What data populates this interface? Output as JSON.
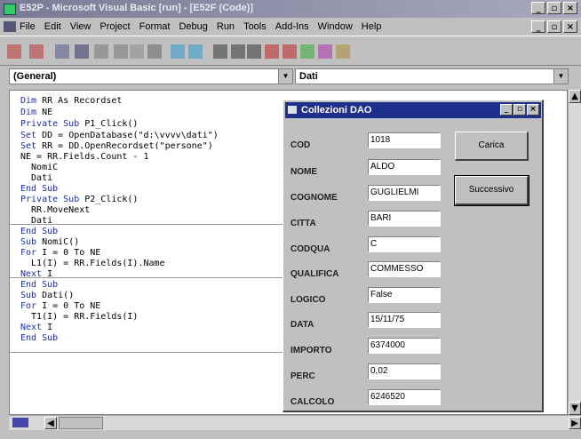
{
  "window": {
    "title": "E52P - Microsoft Visual Basic [run] - [E52F (Code)]"
  },
  "menu": [
    "File",
    "Edit",
    "View",
    "Project",
    "Format",
    "Debug",
    "Run",
    "Tools",
    "Add-Ins",
    "Window",
    "Help"
  ],
  "toolbar_icons": [
    "add-form-icon",
    "add-module-icon",
    "menu-editor-icon",
    "save-icon",
    "cut-icon",
    "copy-icon",
    "paste-icon",
    "find-icon",
    "undo-icon",
    "redo-icon",
    "start-icon",
    "pause-icon",
    "stop-icon",
    "project-explorer-icon",
    "properties-icon",
    "form-layout-icon",
    "object-browser-icon",
    "toolbox-icon"
  ],
  "object_combo": {
    "value": "(General)"
  },
  "proc_combo": {
    "value": "Dati"
  },
  "code": [
    [
      "Dim ",
      "RR As Recordset"
    ],
    [
      "Dim ",
      "NE"
    ],
    [
      "Private Sub ",
      "P1_Click()"
    ],
    [
      "Set ",
      "DD = OpenDatabase(\"d:\\vvvv\\dati\")"
    ],
    [
      "Set ",
      "RR = DD.OpenRecordset(\"persone\")"
    ],
    [
      "",
      "NE = RR.Fields.Count - 1"
    ],
    [
      "",
      "  NomiC"
    ],
    [
      "",
      "  Dati"
    ],
    [
      "End Sub",
      ""
    ],
    [
      "Private Sub ",
      "P2_Click()"
    ],
    [
      "",
      "  RR.MoveNext"
    ],
    [
      "",
      "  Dati"
    ],
    [
      "End Sub",
      ""
    ],
    [
      "Sub ",
      "NomiC()"
    ],
    [
      "For ",
      "I = 0 To NE"
    ],
    [
      "",
      "  L1(I) = RR.Fields(I).Name"
    ],
    [
      "Next ",
      "I"
    ],
    [
      "End Sub",
      ""
    ],
    [
      "Sub ",
      "Dati()"
    ],
    [
      "For ",
      "I = 0 To NE"
    ],
    [
      "",
      "  T1(I) = RR.Fields(I)"
    ],
    [
      "Next ",
      "I"
    ],
    [
      "End Sub",
      ""
    ]
  ],
  "form": {
    "title": "Collezioni DAO",
    "fields": [
      {
        "label": "COD",
        "value": "1018"
      },
      {
        "label": "NOME",
        "value": "ALDO"
      },
      {
        "label": "COGNOME",
        "value": "GUGLIELMI"
      },
      {
        "label": "CITTA",
        "value": "BARI"
      },
      {
        "label": "CODQUA",
        "value": "C"
      },
      {
        "label": "QUALIFICA",
        "value": "COMMESSO"
      },
      {
        "label": "LOGICO",
        "value": "False"
      },
      {
        "label": "DATA",
        "value": "15/11/75"
      },
      {
        "label": "IMPORTO",
        "value": "6374000"
      },
      {
        "label": "PERC",
        "value": "0,02"
      },
      {
        "label": "CALCOLO",
        "value": "6246520"
      }
    ],
    "carica_label": "Carica",
    "successivo_label": "Successivo"
  }
}
